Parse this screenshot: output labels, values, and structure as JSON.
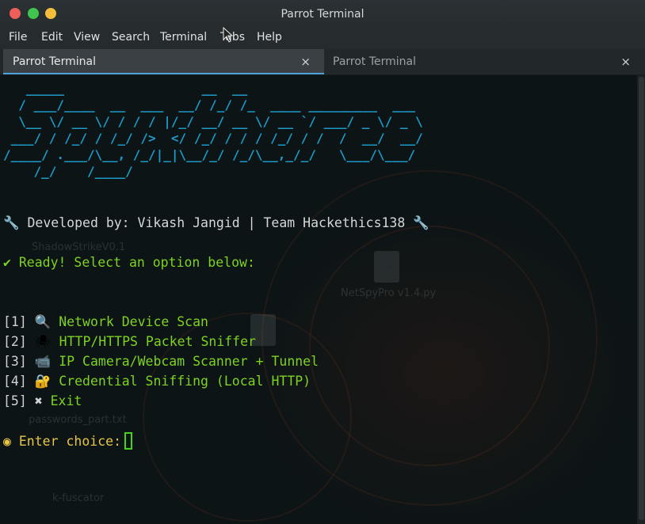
{
  "window": {
    "title": "Parrot Terminal"
  },
  "menu": [
    {
      "label": "File"
    },
    {
      "label": "Edit"
    },
    {
      "label": "View"
    },
    {
      "label": "Search"
    },
    {
      "label": "Terminal"
    },
    {
      "label": "Tabs"
    },
    {
      "label": "Help"
    }
  ],
  "tabs": [
    {
      "label": "Parrot Terminal",
      "close": "×",
      "active": true
    },
    {
      "label": "Parrot Terminal",
      "close": "×",
      "active": false
    }
  ],
  "terminal": {
    "banner": "   _____                  __  __                       \n  / ___/____  __  ___  __/ /_/ /_  ____ _________  ___  \n  \\__ \\/ __ \\/ / / / |/_/ __/ __ \\/ __ `/ ___/ _ \\/ _ \\ \n ___/ / /_/ / /_/ />  </ /_/ / / / /_/ / /  /  __/  __/ \n/____/ .___/\\__, /_/|_|\\__/_/ /_/\\__,_/_/   \\___/\\___/  \n    /_/    /____/                                        ",
    "developed_by": "🔧 Developed by: Vikash Jangid | Team Hackethics138 🔧",
    "ready": "✔ Ready! Select an option below:",
    "options": [
      {
        "num": "[1]",
        "icon": "🔍",
        "label": "Network Device Scan"
      },
      {
        "num": "[2]",
        "icon": "🕷",
        "label": "HTTP/HTTPS Packet Sniffer"
      },
      {
        "num": "[3]",
        "icon": "📹",
        "label": "IP Camera/Webcam Scanner + Tunnel"
      },
      {
        "num": "[4]",
        "icon": "🔐",
        "label": "Credential Sniffing (Local HTTP)"
      },
      {
        "num": "[5]",
        "icon": "✖",
        "label": "Exit"
      }
    ],
    "prompt": "◉ Enter choice:",
    "desktop_bg_labels": [
      "ShadowStrikeV0.1",
      "NetSpyPro v1.4.py",
      "passwords_part.txt",
      "k-fuscator"
    ]
  },
  "colors": {
    "banner": "#1e9ac7",
    "option_text": "#7ed321",
    "prompt": "#e8c547",
    "tab_accent": "#4fa3d8"
  }
}
